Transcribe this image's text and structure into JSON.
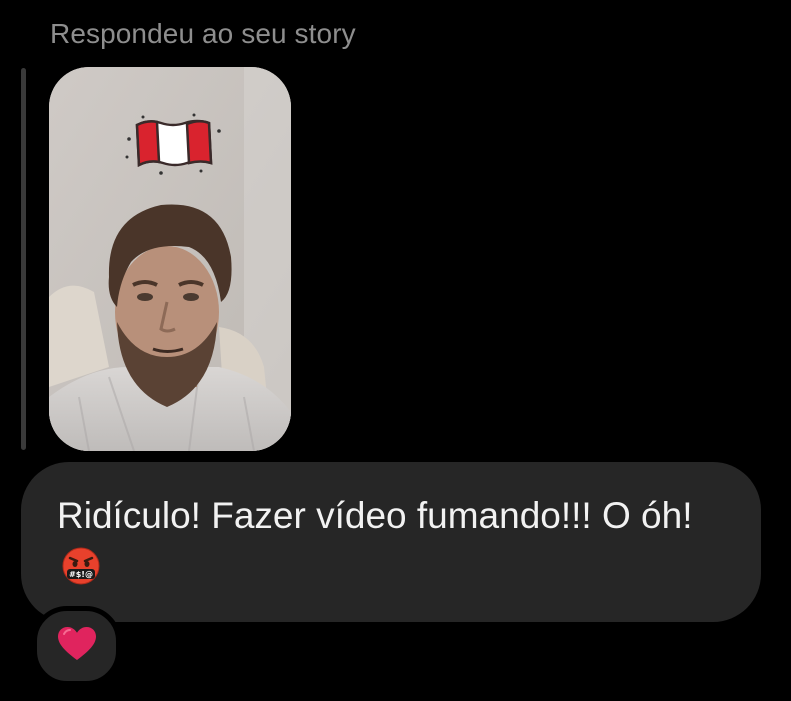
{
  "header": {
    "reply_label": "Respondeu ao seu story"
  },
  "story": {
    "thumbnail_icon": "story-photo-thumbnail",
    "sticker_icon": "peru-flag-icon"
  },
  "message": {
    "text": "Ridículo! Fazer vídeo fumando!!! O óh!",
    "emoji_icon": "face-with-symbols-on-mouth-icon"
  },
  "reaction": {
    "icon": "red-heart-icon"
  },
  "colors": {
    "background": "#000000",
    "bubble": "#262626",
    "label": "#8e8e8e",
    "text": "#f2f2f2",
    "heart": "#e0245e"
  }
}
